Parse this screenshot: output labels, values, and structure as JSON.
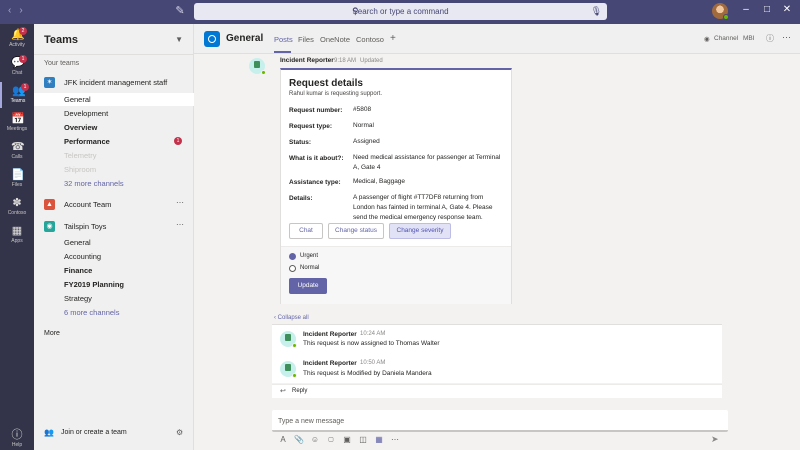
{
  "titlebar": {
    "search_placeholder": "Search or type a command",
    "icons": [
      "back-icon",
      "forward-icon",
      "compose-icon",
      "search-icon",
      "microphone-icon",
      "more-icon",
      "minimize-icon",
      "maximize-icon",
      "close-icon"
    ]
  },
  "rail": {
    "items": [
      {
        "label": "Activity",
        "badge": "2",
        "icon": "bell-icon"
      },
      {
        "label": "Chat",
        "badge": "1",
        "icon": "chat-icon"
      },
      {
        "label": "Teams",
        "badge": "1",
        "icon": "teams-icon"
      },
      {
        "label": "Meetings",
        "badge": "",
        "icon": "calendar-icon"
      },
      {
        "label": "Calls",
        "badge": "",
        "icon": "phone-icon"
      },
      {
        "label": "Files",
        "badge": "",
        "icon": "file-icon"
      },
      {
        "label": "Contoso",
        "badge": "",
        "icon": "contoso-icon"
      },
      {
        "label": "Apps",
        "badge": "",
        "icon": "apps-icon"
      }
    ],
    "help": "Help"
  },
  "teams_pane": {
    "title": "Teams",
    "your_teams": "Your teams",
    "team1": {
      "name": "JFK incident management staff",
      "channels": [
        {
          "label": "General"
        },
        {
          "label": "Development"
        },
        {
          "label": "Overview"
        },
        {
          "label": "Performance",
          "badge": "1"
        },
        {
          "label": "Telemetry"
        },
        {
          "label": "Shiproom"
        },
        {
          "label": "32 more channels"
        }
      ]
    },
    "team2": {
      "name": "Account Team"
    },
    "team3": {
      "name": "Tailspin Toys",
      "channels": [
        {
          "label": "General"
        },
        {
          "label": "Accounting"
        },
        {
          "label": "Finance"
        },
        {
          "label": "FY2019 Planning"
        },
        {
          "label": "Strategy"
        },
        {
          "label": "6 more channels"
        }
      ]
    },
    "more": "More",
    "join": "Join or create a team"
  },
  "channel": {
    "name": "General",
    "tabs": [
      "Posts",
      "Files",
      "OneNote",
      "Contoso"
    ],
    "add_tab": "+",
    "channel_label": "Channel",
    "mbi": "MBI"
  },
  "post": {
    "sender": "Incident Reporter",
    "time": "9:18 AM",
    "status": "Updated",
    "card": {
      "title": "Request details",
      "subtitle": "Rahul kumar is requesting support.",
      "fields": [
        {
          "label": "Request number:",
          "value": "#5808"
        },
        {
          "label": "Request type:",
          "value": "Normal"
        },
        {
          "label": "Status:",
          "value": "Assigned"
        },
        {
          "label": "What is it about?:",
          "value": "Need medical assistance for passenger at Terminal A, Gate 4"
        },
        {
          "label": "Assistance type:",
          "value": "Medical, Baggage"
        },
        {
          "label": "Details:",
          "value": "A passenger of flight #TT7DF8 returning from London has fainted in terminal A, Gate 4. Please send the medical emergency response team."
        }
      ],
      "buttons": [
        "Chat",
        "Change status",
        "Change severity"
      ],
      "options": [
        {
          "label": "Urgent",
          "selected": true
        },
        {
          "label": "Normal",
          "selected": false
        }
      ],
      "submit": "Update"
    }
  },
  "thread": {
    "collapse": "Collapse all",
    "replies": [
      {
        "sender": "Incident Reporter",
        "time": "10:24 AM",
        "text": "This request is now assigned to Thomas Walter"
      },
      {
        "sender": "Incident Reporter",
        "time": "10:50 AM",
        "text": "This request is Modified by Daniela Mandera"
      }
    ],
    "reply": "Reply"
  },
  "composer": {
    "placeholder": "Type a new message",
    "tools": [
      "format-icon",
      "attach-icon",
      "emoji-icon",
      "gif-icon",
      "sticker-icon",
      "meet-icon",
      "app-icon",
      "more-icon"
    ]
  },
  "colors": {
    "accent": "#6264a7",
    "titlebar": "#464775",
    "rail": "#33344a",
    "badge": "#c4314b",
    "presence": "#6bb700"
  }
}
